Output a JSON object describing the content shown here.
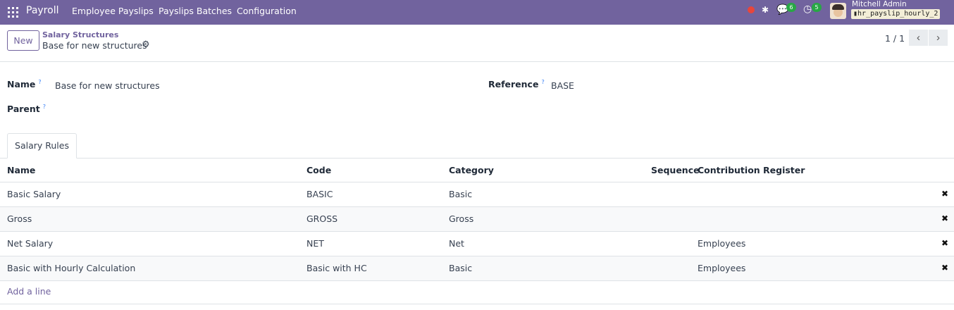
{
  "navbar": {
    "app_name": "Payroll",
    "menu": [
      "Employee Payslips",
      "Payslips Batches",
      "Configuration"
    ],
    "chat_count": "6",
    "activity_count": "5",
    "user_name": "Mitchell Admin",
    "database": "hr_payslip_hourly_2"
  },
  "control": {
    "new_label": "New",
    "breadcrumb": "Salary Structures",
    "record_name": "Base for new structures",
    "pager": "1 / 1"
  },
  "form": {
    "name_label": "Name",
    "name_value": "Base for new structures",
    "reference_label": "Reference",
    "reference_value": "BASE",
    "parent_label": "Parent",
    "help_mark": "?"
  },
  "tabs": [
    "Salary Rules"
  ],
  "table": {
    "columns": [
      "Name",
      "Code",
      "Category",
      "Sequence",
      "Contribution Register"
    ],
    "rows": [
      {
        "name": "Basic Salary",
        "code": "BASIC",
        "category": "Basic",
        "sequence": "",
        "register": ""
      },
      {
        "name": "Gross",
        "code": "GROSS",
        "category": "Gross",
        "sequence": "",
        "register": ""
      },
      {
        "name": "Net Salary",
        "code": "NET",
        "category": "Net",
        "sequence": "",
        "register": "Employees"
      },
      {
        "name": "Basic with Hourly Calculation",
        "code": "Basic with HC",
        "category": "Basic",
        "sequence": "",
        "register": "Employees"
      }
    ],
    "add_line": "Add a line"
  },
  "icons": {
    "apps": "apps-grid-icon",
    "bug": "bug-icon",
    "chat": "chat-icon",
    "clock": "activity-clock-icon",
    "gear": "gear-icon",
    "delete": "delete-x-icon",
    "prev": "chevron-left-icon",
    "next": "chevron-right-icon"
  },
  "colors": {
    "navbar": "#71639e",
    "accent": "#71639e",
    "badge": "#28a745",
    "record_dot": "#e8463b"
  }
}
